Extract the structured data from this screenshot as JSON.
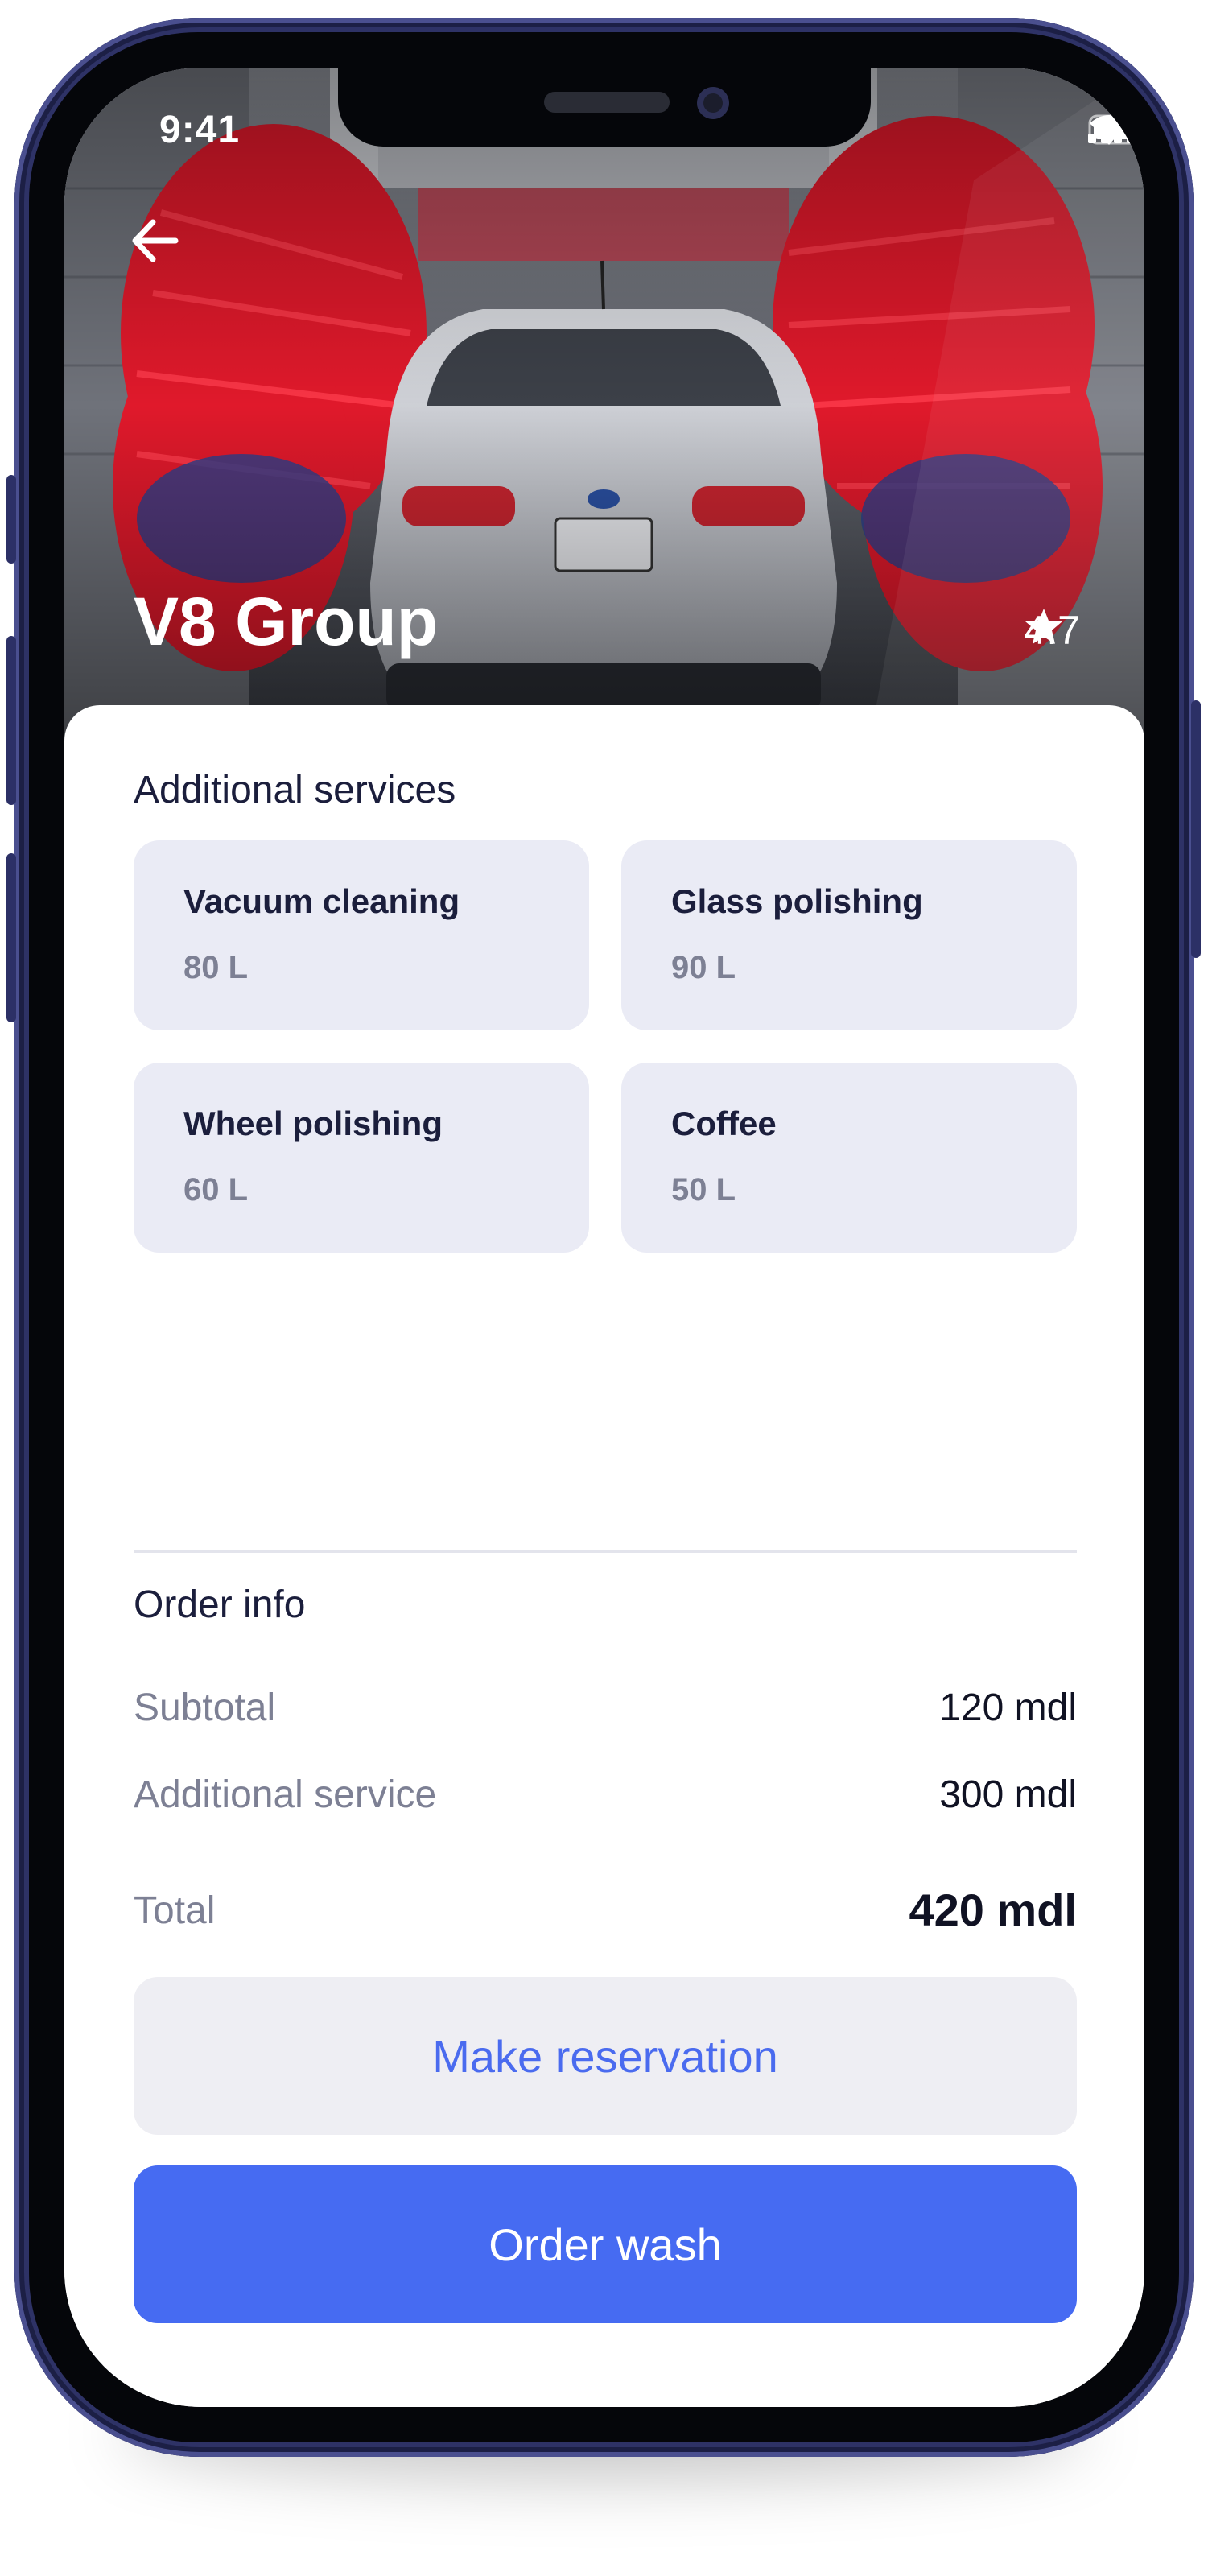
{
  "status_bar": {
    "time": "9:41"
  },
  "header": {
    "title": "V8 Group",
    "rating": "4.7"
  },
  "additional_services": {
    "title": "Additional services",
    "items": [
      {
        "name": "Vacuum cleaning",
        "price": "80 L"
      },
      {
        "name": "Glass polishing",
        "price": "90 L"
      },
      {
        "name": "Wheel polishing",
        "price": "60 L"
      },
      {
        "name": "Coffee",
        "price": "50 L"
      }
    ]
  },
  "order_info": {
    "title": "Order info",
    "subtotal_label": "Subtotal",
    "subtotal_value": "120 mdl",
    "additional_label": "Additional service",
    "additional_value": "300 mdl",
    "total_label": "Total",
    "total_value": "420 mdl"
  },
  "actions": {
    "reserve_label": "Make reservation",
    "order_label": "Order wash"
  },
  "colors": {
    "accent": "#466bf2",
    "card_bg": "#eaebf5",
    "brush_red": "#e0192b",
    "frame": "#2e3266"
  }
}
